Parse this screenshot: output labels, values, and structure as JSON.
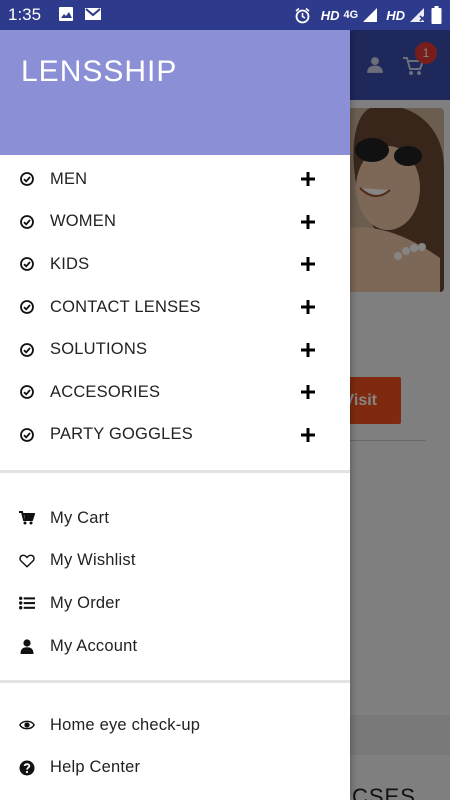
{
  "status_bar": {
    "time": "1:35",
    "hd1": "HD",
    "network": "4G",
    "hd2": "HD"
  },
  "app": {
    "brand": "LENSSHIP",
    "cart_badge": "1",
    "visit_button": "Visit",
    "bottom_text": "CSES"
  },
  "categories": [
    {
      "label": "MEN",
      "icon": "check-circle-icon"
    },
    {
      "label": "WOMEN",
      "icon": "check-circle-icon"
    },
    {
      "label": "KIDS",
      "icon": "check-circle-icon"
    },
    {
      "label": "CONTACT LENSES",
      "icon": "check-circle-icon"
    },
    {
      "label": "SOLUTIONS",
      "icon": "check-circle-icon"
    },
    {
      "label": "ACCESORIES",
      "icon": "check-circle-icon"
    },
    {
      "label": "PARTY GOGGLES",
      "icon": "check-circle-icon"
    }
  ],
  "account_links": [
    {
      "label": "My Cart",
      "icon": "cart-icon"
    },
    {
      "label": "My Wishlist",
      "icon": "heart-icon"
    },
    {
      "label": "My Order",
      "icon": "list-icon"
    },
    {
      "label": "My Account",
      "icon": "user-icon"
    }
  ],
  "help_links": [
    {
      "label": "Home eye check-up",
      "icon": "eye-icon"
    },
    {
      "label": "Help Center",
      "icon": "question-icon"
    }
  ],
  "colors": {
    "toolbar": "#3c4eae",
    "status_bar": "#2e3a8c",
    "drawer_header": "#8a8fd6",
    "visit_button": "#f4511e",
    "badge": "#e53935"
  }
}
